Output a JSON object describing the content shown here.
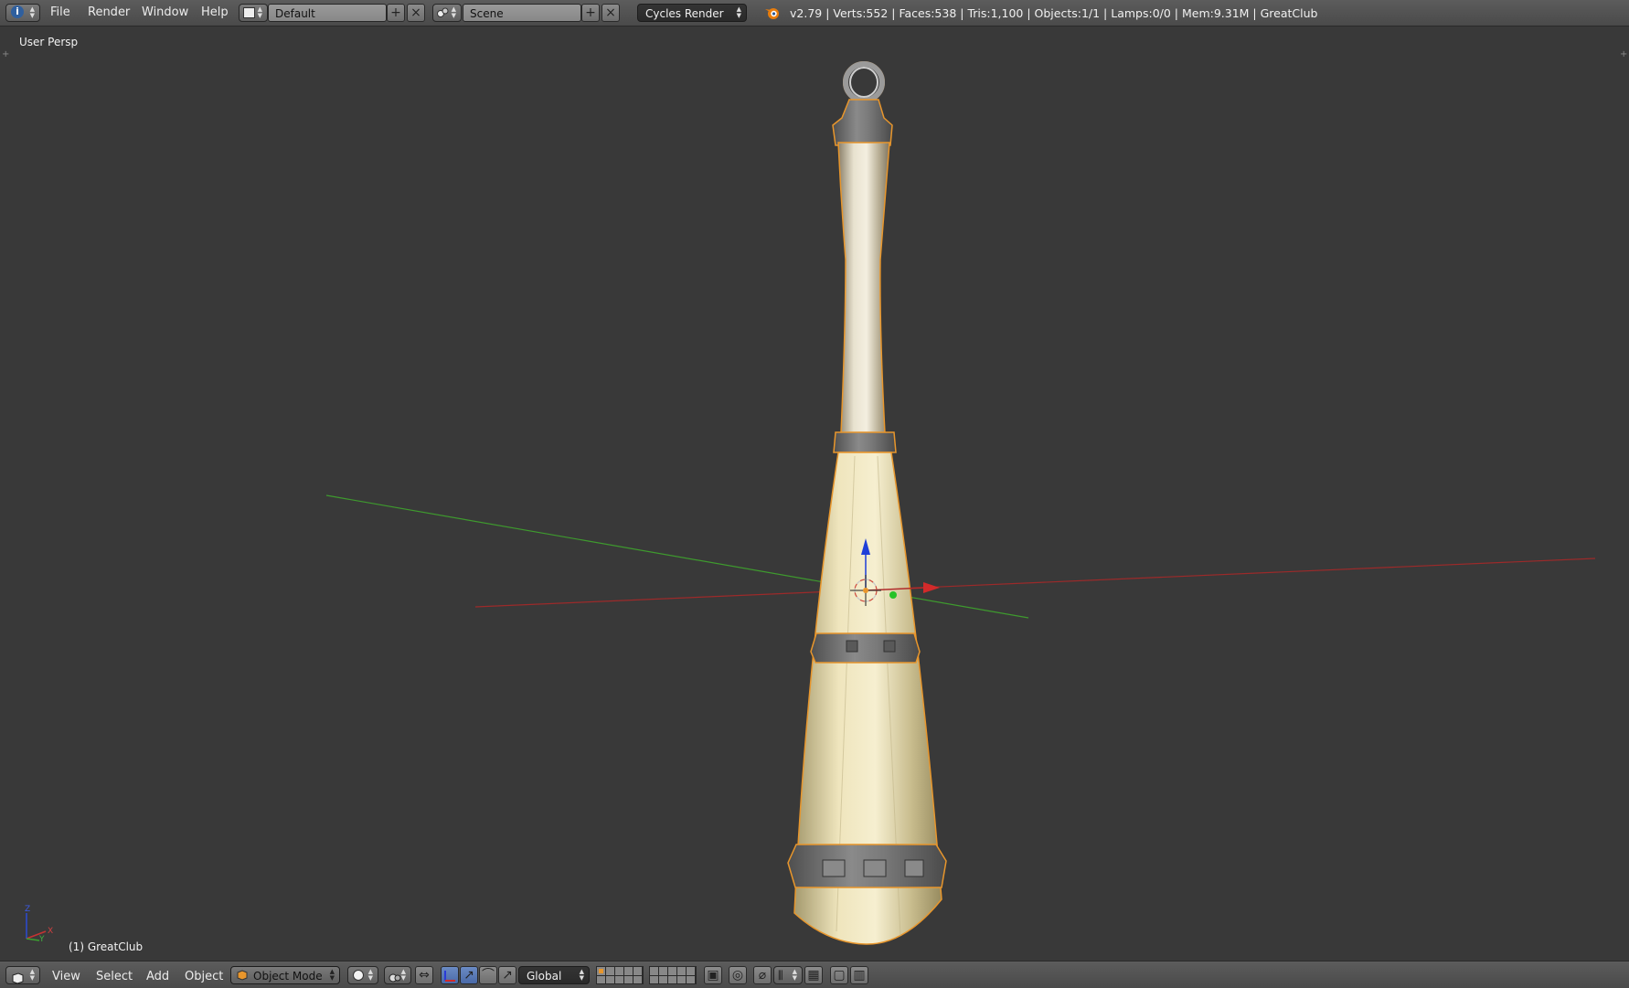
{
  "topbar": {
    "menus": [
      "File",
      "Render",
      "Window",
      "Help"
    ],
    "layout_name": "Default",
    "scene_name": "Scene",
    "render_engine": "Cycles Render",
    "stats": "v2.79 | Verts:552 | Faces:538 | Tris:1,100 | Objects:1/1 | Lamps:0/0 | Mem:9.31M | GreatClub"
  },
  "viewport": {
    "view_label": "User Persp",
    "object_label": "(1) GreatClub",
    "mini_axis_labels": {
      "z": "Z",
      "x": "X",
      "y": "Y"
    }
  },
  "bottombar": {
    "menus": [
      "View",
      "Select",
      "Add",
      "Object"
    ],
    "mode": "Object Mode",
    "orientation": "Global"
  },
  "colors": {
    "background": "#393939",
    "header": "#4f4f4f",
    "x_axis": "#b12a2a",
    "y_axis": "#3e9a2e",
    "z_axis": "#1f3fd8",
    "selection_outline": "#e8962c",
    "handle_color": "#d8cda0",
    "metal_color": "#6d6d6d"
  }
}
